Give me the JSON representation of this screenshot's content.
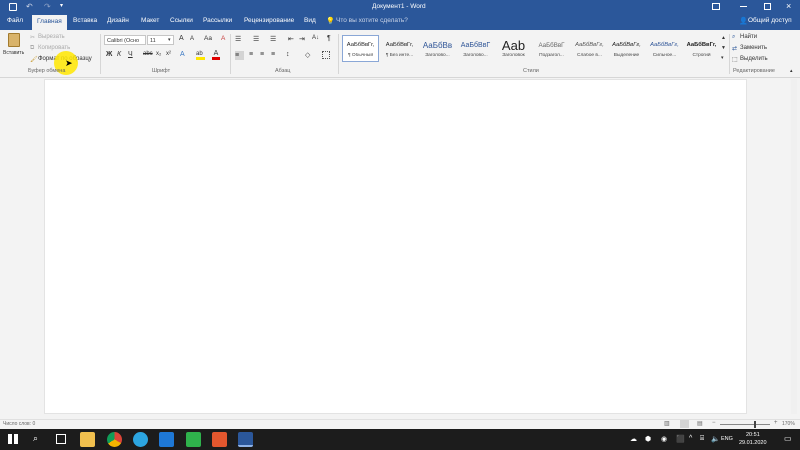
{
  "titlebar": {
    "title": "Документ1 - Word"
  },
  "tabs": [
    {
      "label": "Файл"
    },
    {
      "label": "Главная"
    },
    {
      "label": "Вставка"
    },
    {
      "label": "Дизайн"
    },
    {
      "label": "Макет"
    },
    {
      "label": "Ссылки"
    },
    {
      "label": "Рассылки"
    },
    {
      "label": "Рецензирование"
    },
    {
      "label": "Вид"
    }
  ],
  "tellme": "Что вы хотите сделать?",
  "share": "Общий доступ",
  "clipboard": {
    "paste": "Вставить",
    "cut": "Вырезать",
    "copy": "Копировать",
    "format_painter": "Формат по образцу",
    "group": "Буфер обмена"
  },
  "font": {
    "name": "Calibri (Осно",
    "size": "11",
    "group": "Шрифт"
  },
  "paragraph": {
    "group": "Абзац"
  },
  "styles": {
    "group": "Стили",
    "items": [
      {
        "sample": "АаБбВвГг,",
        "name": "¶ Обычный"
      },
      {
        "sample": "АаБбВвГг,",
        "name": "¶ Без инте..."
      },
      {
        "sample": "АаБбВв",
        "name": "Заголово..."
      },
      {
        "sample": "АаБбВвГ",
        "name": "Заголово..."
      },
      {
        "sample": "Ааb",
        "name": "Заголовок"
      },
      {
        "sample": "АаБбВвГ",
        "name": "Подзагол..."
      },
      {
        "sample": "АаБбВвГг,",
        "name": "Слабое в..."
      },
      {
        "sample": "АаБбВвГг,",
        "name": "Выделение"
      },
      {
        "sample": "АаБбВвГг,",
        "name": "Сильное..."
      },
      {
        "sample": "АаБбВвГг,",
        "name": "Строгий"
      }
    ]
  },
  "editing": {
    "find": "Найти",
    "replace": "Заменить",
    "select": "Выделить",
    "group": "Редактирование"
  },
  "status": {
    "words": "Число слов: 0",
    "zoom": "170%"
  },
  "taskbar": {
    "time": "20:51",
    "date": "29.01.2020",
    "lang": "ENG"
  },
  "colors": {
    "accent": "#2b579a",
    "highlight": "#ffe600",
    "font_color": "#e00000"
  }
}
